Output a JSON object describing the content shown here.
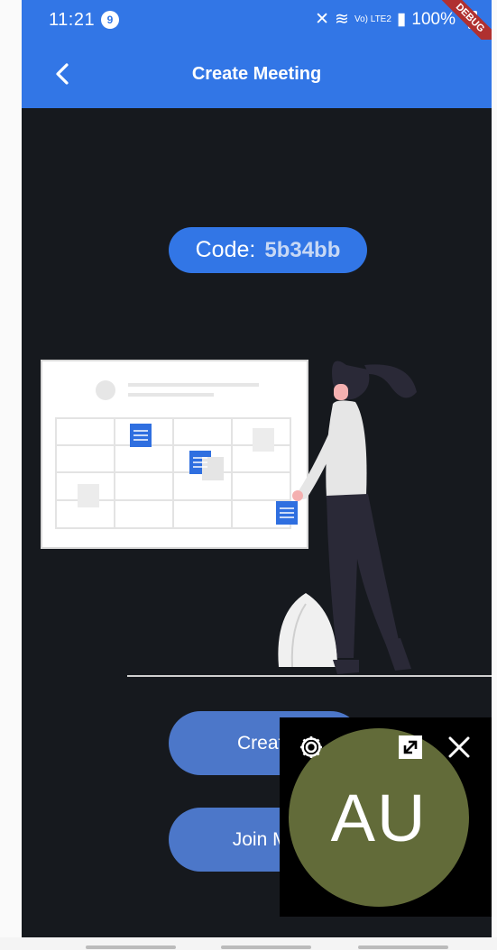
{
  "status_bar": {
    "time": "11:21",
    "notification_badge": "9",
    "network_label": "Vo) LTE2",
    "battery": "100%"
  },
  "debug_banner": "DEBUG",
  "app_bar": {
    "title": "Create Meeting"
  },
  "meeting_code": {
    "label": "Code:",
    "value": "5b34bb"
  },
  "buttons": {
    "create": "Create",
    "join": "Join Me"
  },
  "pip": {
    "initials": "AU"
  },
  "colors": {
    "accent": "#3276e6",
    "background": "#16191e",
    "button": "#4c77c9",
    "avatar": "#626b39"
  }
}
